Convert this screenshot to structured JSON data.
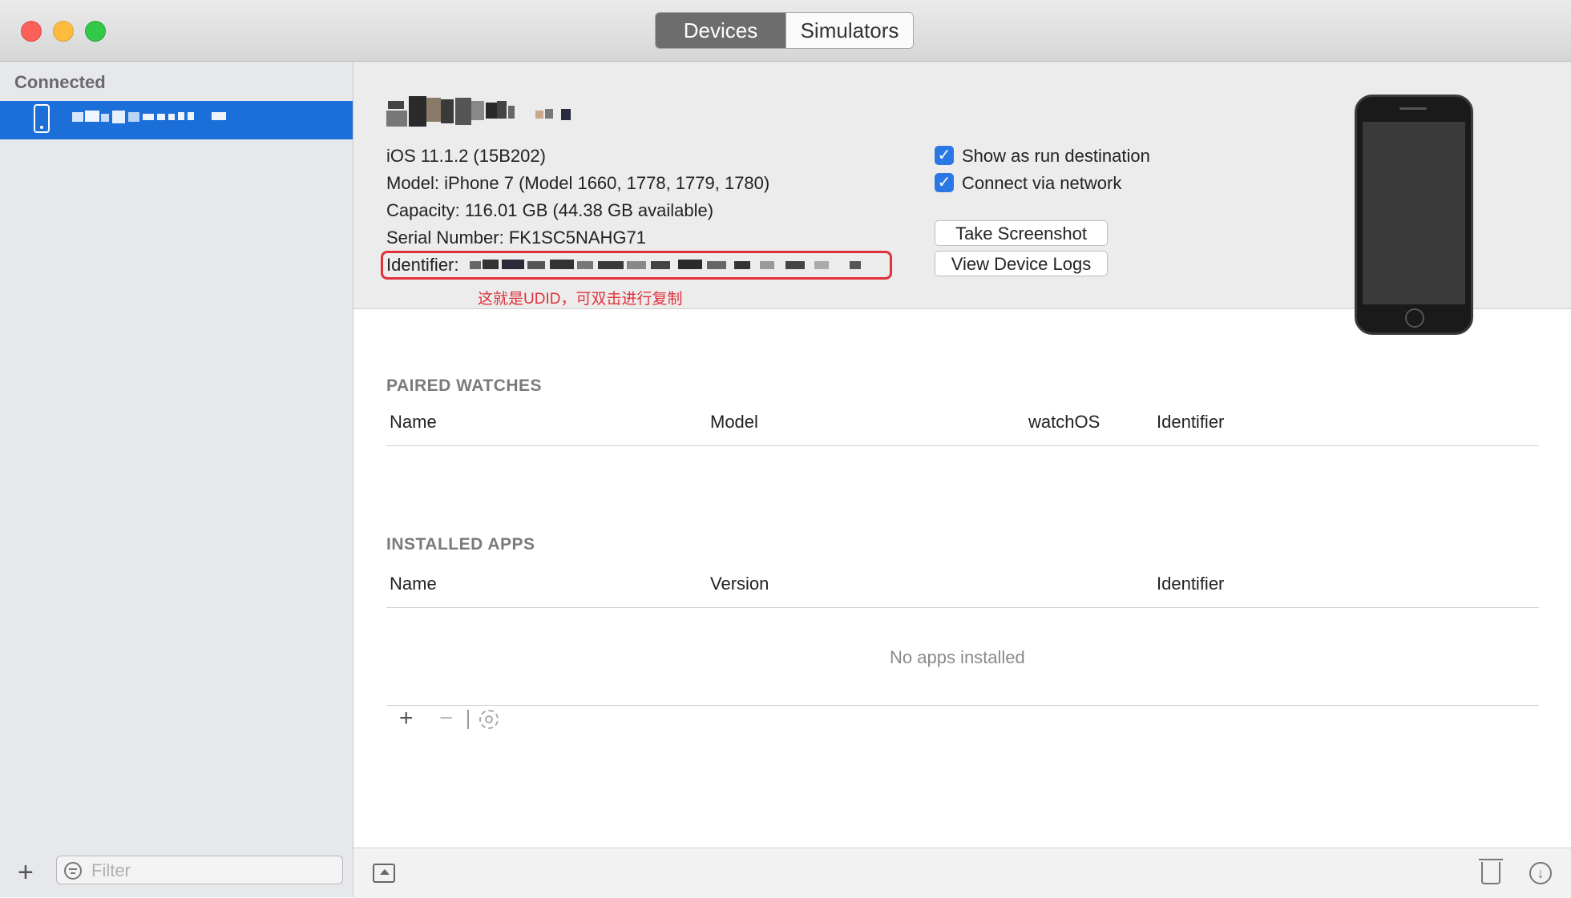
{
  "window": {
    "tabs": [
      {
        "label": "Devices",
        "selected": true
      },
      {
        "label": "Simulators",
        "selected": false
      }
    ]
  },
  "sidebar": {
    "section_title": "Connected",
    "filter_placeholder": "Filter",
    "icons": {
      "add": "plus-icon",
      "filter": "filter-icon",
      "device": "iphone-icon"
    }
  },
  "device": {
    "os": "iOS 11.1.2 (15B202)",
    "model": "Model: iPhone 7 (Model 1660, 1778, 1779, 1780)",
    "capacity": "Capacity: 116.01 GB (44.38 GB available)",
    "serial": "Serial Number: FK1SC5NAHG71",
    "identifier_label": "Identifier:",
    "annotation": "这就是UDID，可双击进行复制",
    "show_as_run_destination": {
      "label": "Show as run destination",
      "checked": true
    },
    "connect_via_network": {
      "label": "Connect via network",
      "checked": true
    },
    "take_screenshot_label": "Take Screenshot",
    "view_logs_label": "View Device Logs"
  },
  "paired_watches": {
    "title": "PAIRED WATCHES",
    "columns": [
      "Name",
      "Model",
      "watchOS",
      "Identifier"
    ]
  },
  "installed_apps": {
    "title": "INSTALLED APPS",
    "columns": [
      "Name",
      "Version",
      "Identifier"
    ],
    "empty_message": "No apps installed",
    "toolbar_icons": [
      "plus-icon",
      "minus-icon",
      "gear-icon"
    ]
  },
  "colors": {
    "selection": "#1c6fd9",
    "checkbox": "#2b78e4",
    "annotation": "#e0313a",
    "segment_selected": "#6d6d6d"
  }
}
